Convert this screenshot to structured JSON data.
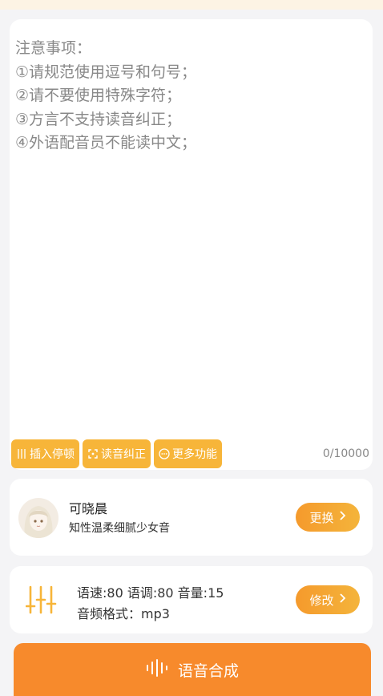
{
  "editor": {
    "notice": "注意事项：\n①请规范使用逗号和句号；\n②请不要使用特殊字符；\n③方言不支持读音纠正；\n④外语配音员不能读中文；",
    "counter": "0/10000"
  },
  "tools": [
    {
      "label": "插入停顿",
      "icon": "pause-insert-icon"
    },
    {
      "label": "读音纠正",
      "icon": "pronunciation-icon"
    },
    {
      "label": "更多功能",
      "icon": "more-icon"
    }
  ],
  "voice": {
    "name": "可晓晨",
    "desc": "知性温柔细腻少女音",
    "change_label": "更换"
  },
  "settings": {
    "params": "语速:80 语调:80 音量:15",
    "format": "音频格式：mp3",
    "modify_label": "修改"
  },
  "synthesize": {
    "label": "语音合成"
  },
  "colors": {
    "accent": "#f7b539",
    "primary": "#f78a2c"
  }
}
